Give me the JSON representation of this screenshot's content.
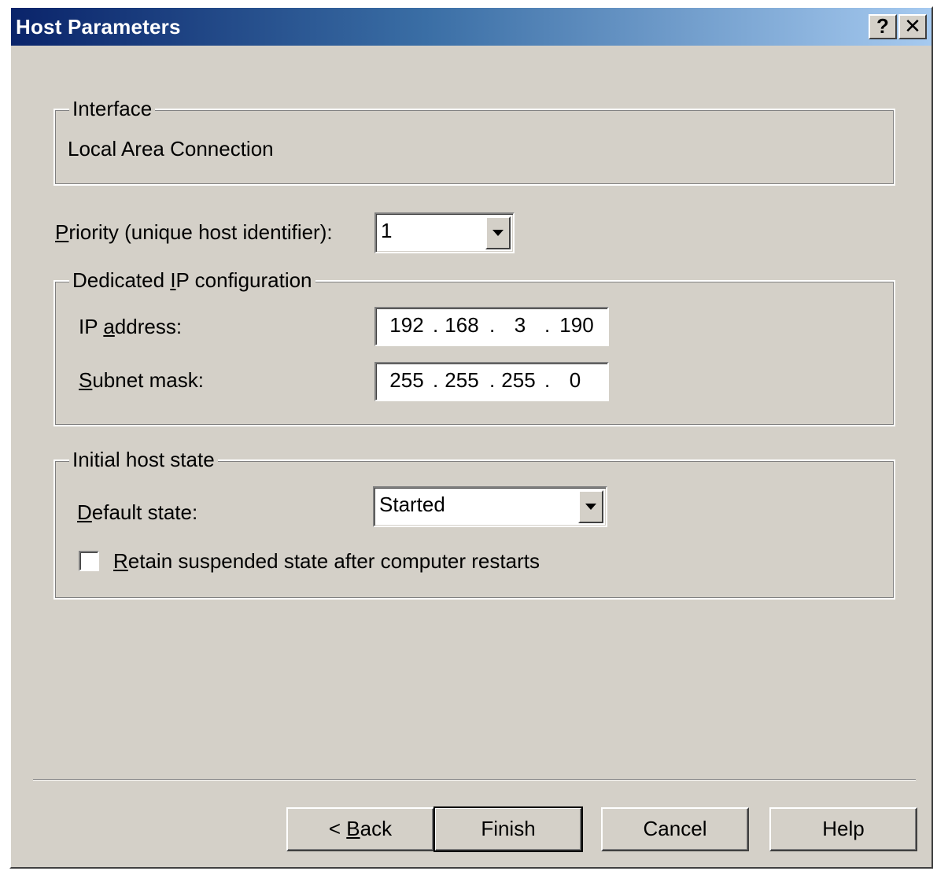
{
  "window": {
    "title": "Host Parameters",
    "help_glyph": "?",
    "close_glyph": "✕"
  },
  "interface_group": {
    "legend": "Interface",
    "value": "Local Area Connection"
  },
  "priority": {
    "label_accel": "P",
    "label_rest": "riority (unique host identifier):",
    "selected": "1"
  },
  "dedicated_ip": {
    "legend_pre": "Dedicated ",
    "legend_accel": "I",
    "legend_post": "P configuration",
    "ip_label_pre": "IP ",
    "ip_label_accel": "a",
    "ip_label_post": "ddress:",
    "ip_octets": [
      "192",
      "168",
      "3",
      "190"
    ],
    "mask_label_accel": "S",
    "mask_label_post": "ubnet mask:",
    "mask_octets": [
      "255",
      "255",
      "255",
      "0"
    ],
    "octet_separator": "."
  },
  "host_state": {
    "legend": "Initial host state",
    "default_label_accel": "D",
    "default_label_post": "efault state:",
    "default_selected": "Started",
    "retain_accel": "R",
    "retain_post": "etain suspended state after computer restarts",
    "retain_checked": false
  },
  "buttons": {
    "back_pre": "< ",
    "back_accel": "B",
    "back_post": "ack",
    "finish": "Finish",
    "cancel": "Cancel",
    "help": "Help"
  }
}
